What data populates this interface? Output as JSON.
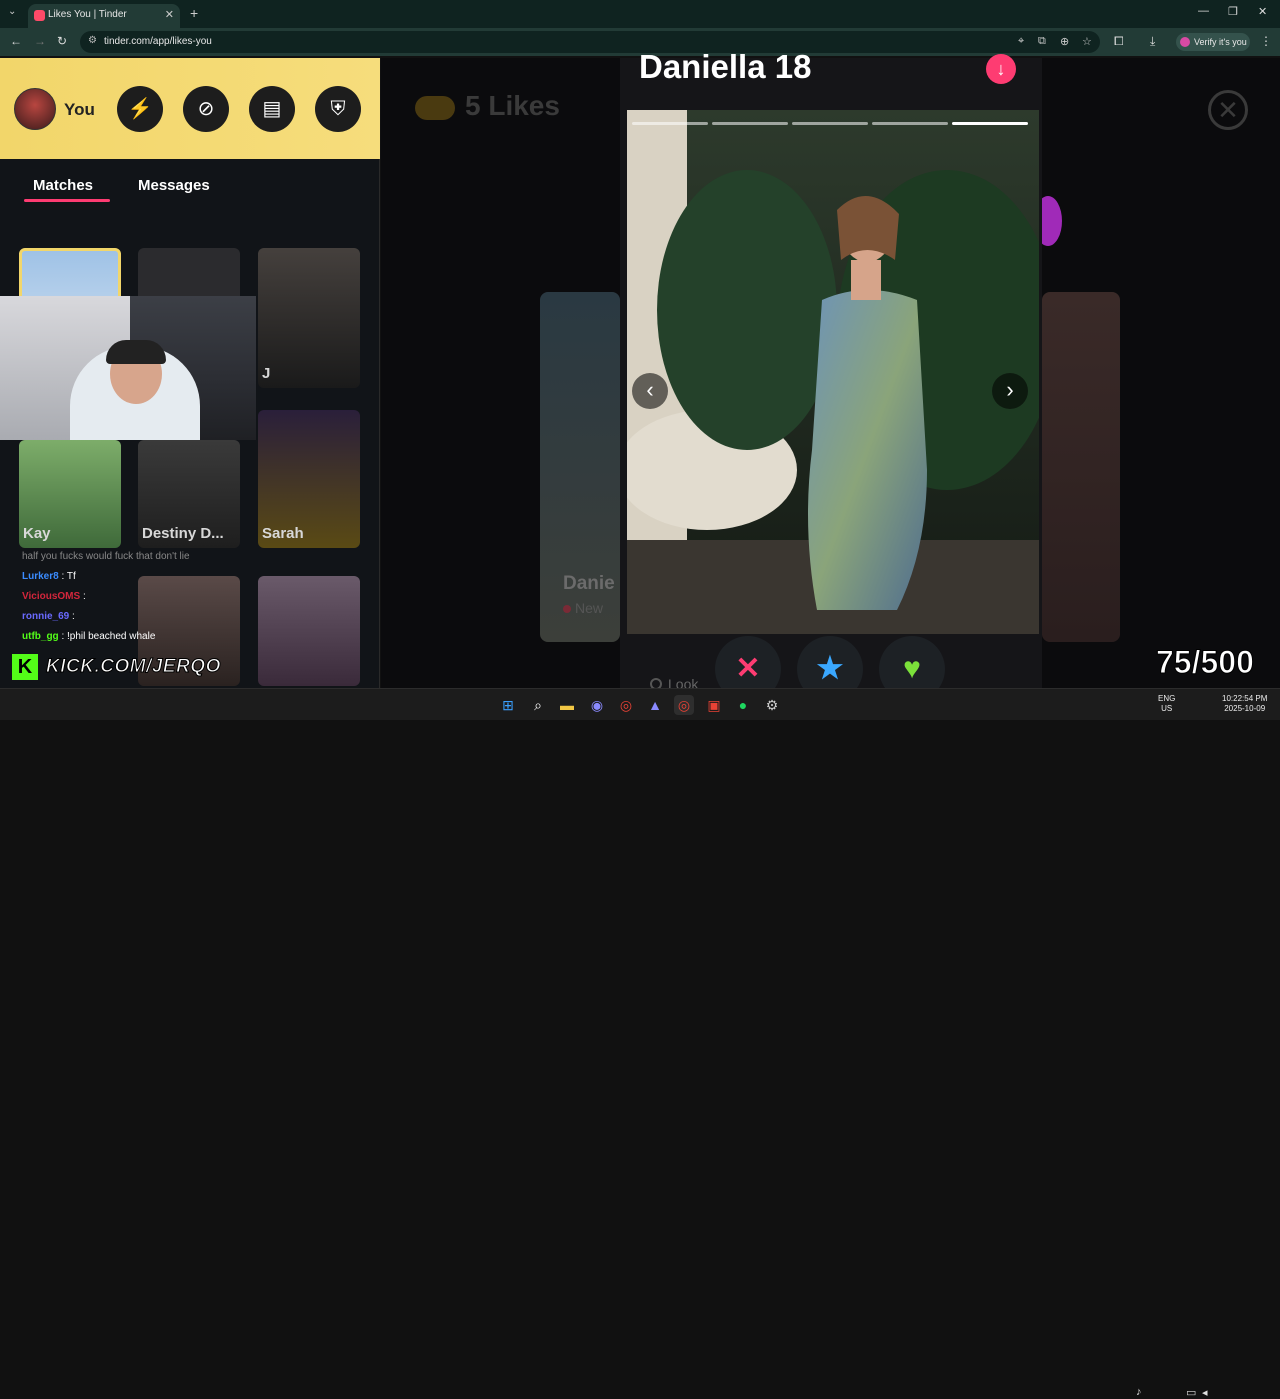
{
  "browser": {
    "tab_title": "Likes You | Tinder",
    "url": "tinder.com/app/likes-you",
    "verify_label": "Verify it's you"
  },
  "sidebar": {
    "you_label": "You",
    "tabs": [
      "Matches",
      "Messages"
    ],
    "tiles": [
      {
        "name": "J"
      },
      {
        "name": "Kay"
      },
      {
        "name": "Destiny D..."
      },
      {
        "name": "Sarah"
      }
    ]
  },
  "chat": [
    {
      "user": "Lurker8",
      "message": ": Tf",
      "color": "#3b8cff"
    },
    {
      "user": "ViciousOMS",
      "message": ":",
      "color": "#d4263c"
    },
    {
      "user": "ronnie_69",
      "message": ":",
      "color": "#6a6aff"
    },
    {
      "user": "utfb_gg",
      "message": ": !phil beached whale",
      "color": "#53fc18"
    }
  ],
  "chat_partial": "half you fucks would fuck that don't lie",
  "overlay": {
    "kick_url": "KICK.COM/JERQO",
    "counter": "75/500"
  },
  "main": {
    "likes_title": "5 Likes",
    "bg_card_name": "Danie",
    "bg_card_badge": "New"
  },
  "profile": {
    "name_age": "Daniella 18",
    "photo_count": 5,
    "current_photo": 5,
    "look_label": "Look"
  },
  "taskbar": {
    "lang_top": "ENG",
    "lang_bottom": "US",
    "time": "10:22:54 PM",
    "date": "2025-10-09"
  },
  "colors": {
    "tinder_pink": "#fe3c72",
    "kick_green": "#53fc18",
    "sidebar_header": "#f2d66a"
  }
}
